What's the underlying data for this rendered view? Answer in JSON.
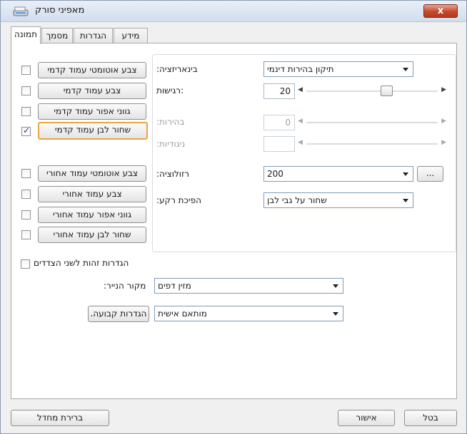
{
  "window": {
    "title": "מאפיני סורק",
    "close_label": "x"
  },
  "tabs": [
    {
      "label": "תמונה",
      "active": true
    },
    {
      "label": "מסמך"
    },
    {
      "label": "הגדרות"
    },
    {
      "label": "מידע"
    }
  ],
  "left_options": [
    {
      "label": "צבע אוטומטי עמוד קדמי",
      "checked": false
    },
    {
      "label": "צבע עמוד קדמי",
      "checked": false
    },
    {
      "label": "גווני אפור עמוד קדמי",
      "checked": false
    },
    {
      "label": "שחור לבן עמוד קדמי",
      "checked": true,
      "focused": true
    },
    {
      "label": "צבע אוטומטי עמוד אחורי",
      "checked": false
    },
    {
      "label": "צבע עמוד אחורי",
      "checked": false
    },
    {
      "label": "גווני אפור עמוד אחורי",
      "checked": false
    },
    {
      "label": "שחור לבן עמוד אחורי",
      "checked": false
    }
  ],
  "settings": {
    "binarization_label": ":בינאריזציה",
    "binarization_value": "תיקון בהירות דינמי",
    "sensitivity_label": "רגישות:",
    "sensitivity_value": "20",
    "brightness_label": ":בהירות",
    "brightness_value": "0",
    "contrast_label": ":ניגודיות",
    "contrast_value": "",
    "resolution_label": ":רזולוציה",
    "resolution_value": "200",
    "resolution_more": "...",
    "invert_label": ":הפיכת רקע",
    "invert_value": "שחור על גבי לבן"
  },
  "same_both_sides": {
    "label": "הגדרות זהות לשני הצדדים",
    "checked": false
  },
  "paper_source": {
    "label": ":מקור הנייר",
    "value": "מזין דפים"
  },
  "preset": {
    "button": ".הגדרות קבועה",
    "value": "מותאם אישית"
  },
  "footer": {
    "defaults": "ברירת מחדל",
    "ok": "אישור",
    "cancel": "בטל"
  },
  "colors": {
    "focus_border": "#e8a646",
    "close_button": "#c4472b",
    "check_mark": "#2a3f8a"
  }
}
